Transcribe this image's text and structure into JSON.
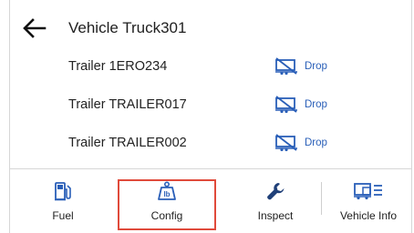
{
  "header": {
    "title": "Vehicle Truck301",
    "back_icon": "arrow-left-icon"
  },
  "trailers": [
    {
      "label": "Trailer 1ERO234",
      "action_label": "Drop",
      "action_icon": "trailer-drop-icon"
    },
    {
      "label": "Trailer TRAILER017",
      "action_label": "Drop",
      "action_icon": "trailer-drop-icon"
    },
    {
      "label": "Trailer TRAILER002",
      "action_label": "Drop",
      "action_icon": "trailer-drop-icon"
    }
  ],
  "tabs": [
    {
      "label": "Fuel",
      "icon": "fuel-pump-icon"
    },
    {
      "label": "Config",
      "icon": "weight-lb-icon",
      "selected": true
    },
    {
      "label": "Inspect",
      "icon": "wrench-icon"
    },
    {
      "label": "Vehicle Info",
      "icon": "vehicle-info-icon"
    }
  ],
  "colors": {
    "accent": "#2a5fb8",
    "selection_border": "#e04a3b",
    "text": "#1f1f1f",
    "divider": "#d6d6d6"
  }
}
